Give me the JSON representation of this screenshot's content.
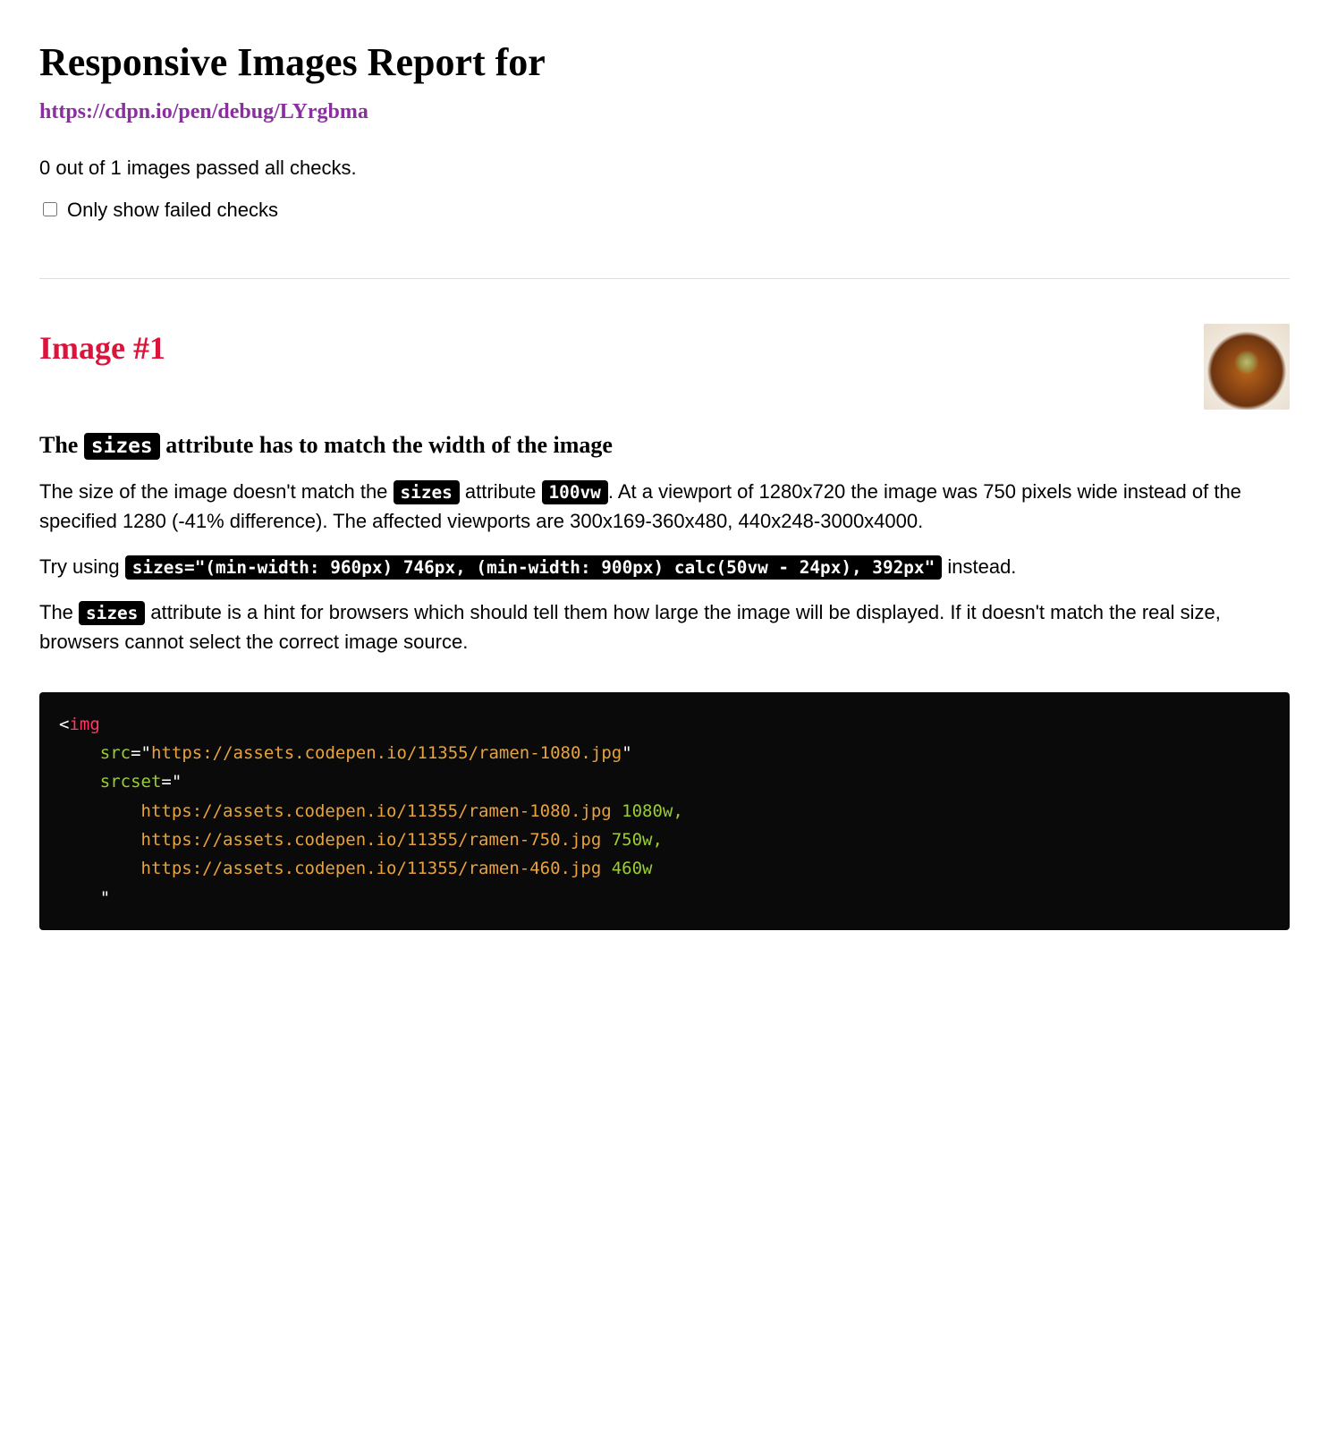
{
  "header": {
    "title": "Responsive Images Report for",
    "url": "https://cdpn.io/pen/debug/LYrgbma"
  },
  "summary": {
    "text": "0 out of 1 images passed all checks."
  },
  "filter": {
    "label": "Only show failed checks"
  },
  "image": {
    "heading": "Image #1",
    "check_title_pre": "The ",
    "check_title_code": "sizes",
    "check_title_post": " attribute has to match the width of the image",
    "p1_a": "The size of the image doesn't match the ",
    "p1_code1": "sizes",
    "p1_b": " attribute ",
    "p1_code2": "100vw",
    "p1_c": ". At a viewport of 1280x720 the image was 750 pixels wide instead of the specified 1280 (-41% difference). The affected viewports are 300x169-360x480, 440x248-3000x4000.",
    "p2_a": "Try using ",
    "p2_code": "sizes=\"(min-width: 960px) 746px, (min-width: 900px) calc(50vw - 24px), 392px\"",
    "p2_b": " instead.",
    "p3_a": "The ",
    "p3_code": "sizes",
    "p3_b": " attribute is a hint for browsers which should tell them how large the image will be displayed. If it doesn't match the real size, browsers cannot select the correct image source."
  },
  "code": {
    "tag": "img",
    "attr_src": "src",
    "val_src": "https://assets.codepen.io/11355/ramen-1080.jpg",
    "attr_srcset": "srcset",
    "srcset_line1_url": "https://assets.codepen.io/11355/ramen-1080.jpg",
    "srcset_line1_w": " 1080w,",
    "srcset_line2_url": "https://assets.codepen.io/11355/ramen-750.jpg",
    "srcset_line2_w": " 750w,",
    "srcset_line3_url": "https://assets.codepen.io/11355/ramen-460.jpg",
    "srcset_line3_w": " 460w"
  }
}
